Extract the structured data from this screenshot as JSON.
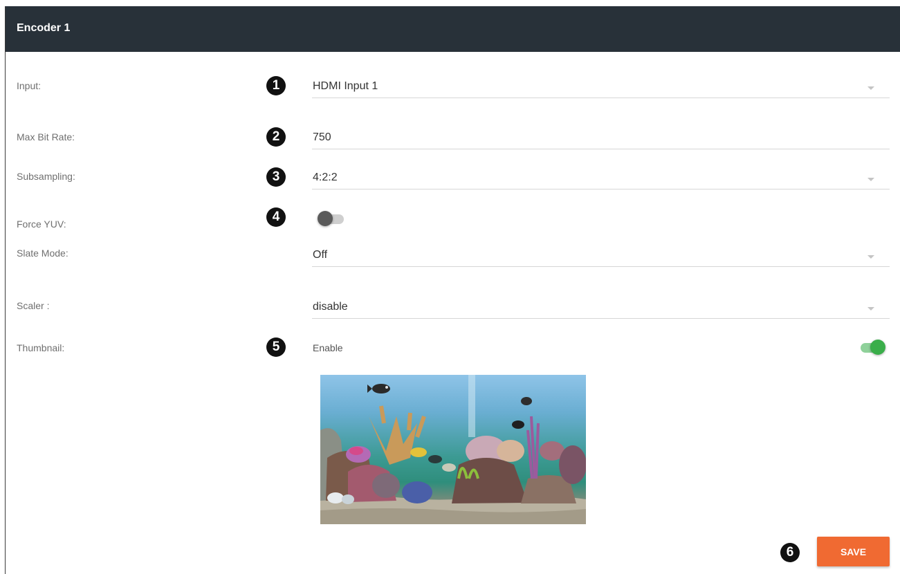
{
  "header": {
    "title": "Encoder 1"
  },
  "rows": {
    "input": {
      "label": "Input:",
      "badge": "1",
      "value": "HDMI Input 1"
    },
    "max_bit_rate": {
      "label": "Max Bit Rate:",
      "badge": "2",
      "value": "750"
    },
    "subsampling": {
      "label": "Subsampling:",
      "badge": "3",
      "value": "4:2:2"
    },
    "force_yuv": {
      "label": "Force YUV:",
      "badge": "4",
      "enabled": false
    },
    "slate_mode": {
      "label": "Slate Mode:",
      "value": "Off"
    },
    "scaler": {
      "label": "Scaler :",
      "value": "disable"
    },
    "thumbnail": {
      "label": "Thumbnail:",
      "badge": "5",
      "toggle_label": "Enable",
      "enabled": true
    }
  },
  "save": {
    "badge": "6",
    "label": "SAVE"
  },
  "colors": {
    "header_bg": "#283139",
    "accent_save": "#f06a32",
    "toggle_on": "#3aae4a",
    "toggle_off": "#5a5a5a"
  },
  "icons": {
    "dropdown": "caret-down-icon",
    "thumbnail": "aquarium-thumbnail-image"
  }
}
